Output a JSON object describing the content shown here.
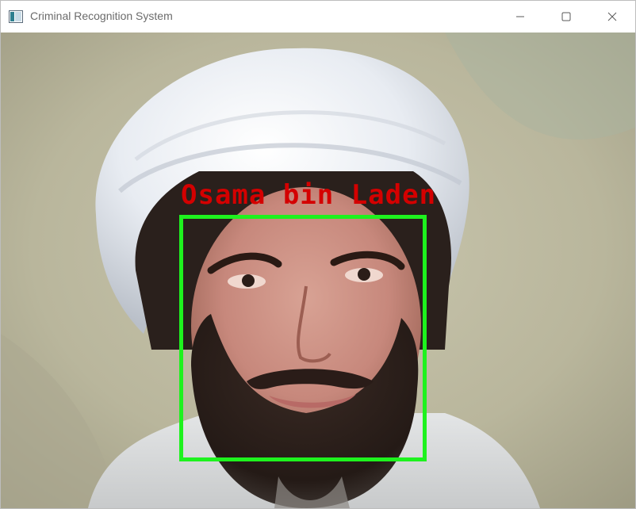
{
  "window": {
    "title": "Criminal Recognition System",
    "icon": "app-window-icon",
    "controls": {
      "minimize_icon": "minimize-icon",
      "maximize_icon": "maximize-icon",
      "close_icon": "close-icon"
    }
  },
  "camera_feed": {
    "detected_name": "Osama bin Laden",
    "box_color": "#1ef21e",
    "label_color": "#d40000"
  }
}
